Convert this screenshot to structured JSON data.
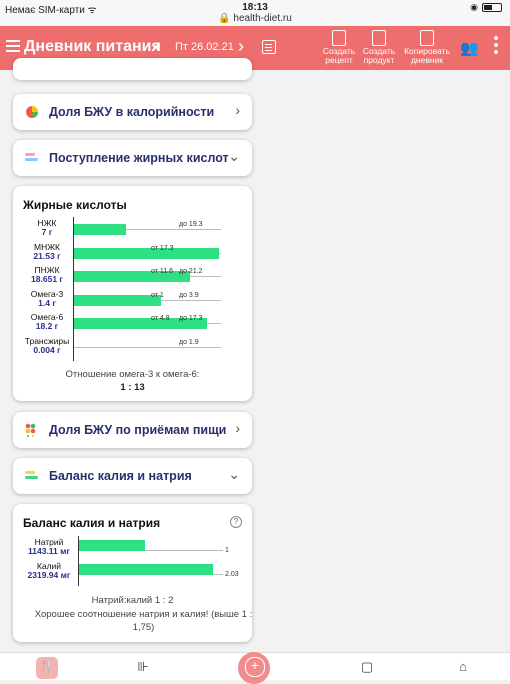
{
  "statusbar": {
    "carrier": "Немає SIM-карти ᯤ",
    "time": "18:13",
    "url": "🔒 health-diet.ru"
  },
  "header": {
    "title": "Дневник питания",
    "date": "Пт 26.02.21",
    "buttons": [
      {
        "label": "Создать рецепт"
      },
      {
        "label": "Создать продукт"
      },
      {
        "label": "Копировать дневник"
      }
    ]
  },
  "rows": {
    "bju_calories": "Доля БЖУ в калорийности",
    "fatty_acids": "Поступление жирных кислот",
    "bju_meals": "Доля БЖУ по приёмам пищи",
    "potassium_sodium": "Баланс калия и натрия"
  },
  "fatty_panel": {
    "title": "Жирные кислоты",
    "items": [
      {
        "name": "НЖК",
        "value": "7 г",
        "fill": 0.36,
        "min_label": "",
        "max_label": "до 19.3"
      },
      {
        "name": "МНЖК",
        "value": "21.53 г",
        "fill": 1.0,
        "min_label": "от 17.3",
        "max_label": ""
      },
      {
        "name": "ПНЖК",
        "value": "18.651 г",
        "fill": 0.8,
        "min_label": "от 11.6",
        "max_label": "до 21.2"
      },
      {
        "name": "Омега-3",
        "value": "1.4 г",
        "fill": 0.6,
        "min_label": "от 1",
        "max_label": "до 3.9"
      },
      {
        "name": "Омега-6",
        "value": "18.2 г",
        "fill": 0.92,
        "min_label": "от 4.8",
        "max_label": "до 17.3"
      },
      {
        "name": "Трансжиры",
        "value": "0.004 г",
        "fill": 0.0,
        "min_label": "",
        "max_label": "до 1.9"
      }
    ],
    "ratio_text": "Отношение омега-3 к омега-6:",
    "ratio_value": "1 : 13"
  },
  "balance_panel": {
    "title": "Баланс калия и натрия",
    "help": "?",
    "items": [
      {
        "name": "Натрий",
        "value": "1143.11 мг",
        "fill": 0.49,
        "label": "1"
      },
      {
        "name": "Калий",
        "value": "2319.94 мг",
        "fill": 0.99,
        "label": "2.03"
      }
    ],
    "ratio": "Натрий:калий 1 : 2",
    "note": "Хорошее соотношение натрия и калия! (выше 1 : 1,75)"
  },
  "colors": {
    "header": "#ee6d6d",
    "bar": "#2ee082",
    "label": "#2a2f6e"
  }
}
